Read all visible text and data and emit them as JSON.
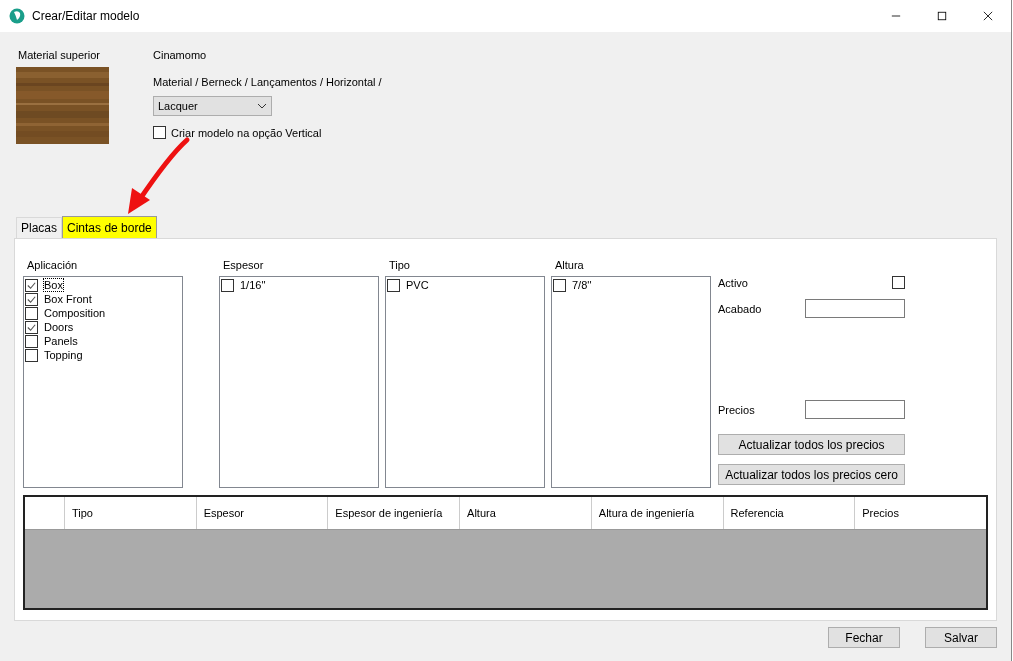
{
  "window": {
    "title": "Crear/Editar modelo"
  },
  "material": {
    "label": "Material superior",
    "name": "Cinamomo",
    "path": "Material / Berneck / Lançamentos / Horizontal /",
    "finish": "Lacquer",
    "vertical_option": {
      "label": "Criar modelo na opção  Vertical",
      "checked": false
    }
  },
  "tabs": [
    {
      "label": "Placas",
      "selected": false
    },
    {
      "label": "Cintas de borde",
      "selected": true
    }
  ],
  "lists": [
    {
      "title": "Aplicación",
      "items": [
        {
          "label": "Box",
          "checked": true,
          "focused": true
        },
        {
          "label": "Box Front",
          "checked": true,
          "focused": false
        },
        {
          "label": "Composition",
          "checked": false,
          "focused": false
        },
        {
          "label": "Doors",
          "checked": true,
          "focused": false
        },
        {
          "label": "Panels",
          "checked": false,
          "focused": false
        },
        {
          "label": "Topping",
          "checked": false,
          "focused": false
        }
      ]
    },
    {
      "title": "Espesor",
      "items": [
        {
          "label": "1/16''",
          "checked": false,
          "focused": false
        }
      ]
    },
    {
      "title": "Tipo",
      "items": [
        {
          "label": "PVC",
          "checked": false,
          "focused": false
        }
      ]
    },
    {
      "title": "Altura",
      "items": [
        {
          "label": "7/8''",
          "checked": false,
          "focused": false
        }
      ]
    }
  ],
  "activo": {
    "label": "Activo",
    "checked": false
  },
  "acabado": {
    "label": "Acabado"
  },
  "precios": {
    "label": "Precios"
  },
  "price_buttons": [
    "Actualizar todos los precios",
    "Actualizar todos los precios cero"
  ],
  "table": {
    "columns": [
      "Tipo",
      "Espesor",
      "Espesor de ingeniería",
      "Altura",
      "Altura de ingeniería",
      "Referencia",
      "Precios"
    ]
  },
  "buttons": [
    "Fechar",
    "Salvar"
  ]
}
